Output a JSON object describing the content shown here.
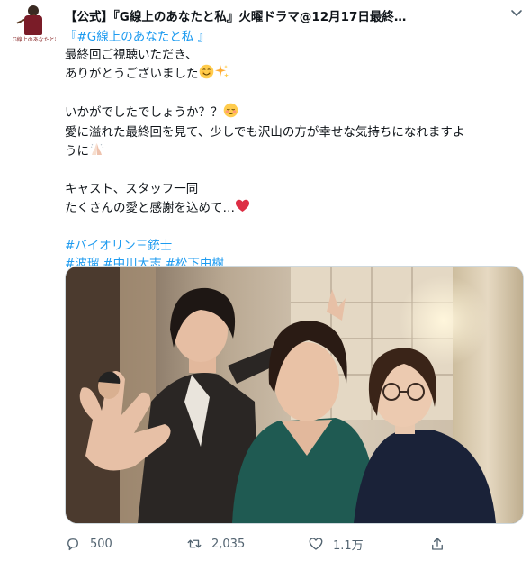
{
  "author": {
    "avatar_logo_text": "G線上のあなたと私",
    "name_line": "【公式】『G線上のあなたと私』火曜ドラマ@12月17日最終…"
  },
  "tweet": {
    "title_tag": "『#G線上のあなたと私 』",
    "lines": [
      "最終回ご視聴いただき、",
      "ありがとうございました",
      "いかがでしたでしょうか？？",
      "愛に溢れた最終回を見て、少しでも沢山の方が幸せな気持ちになれますよ",
      "うに",
      "キャスト、スタッフ一同",
      "たくさんの愛と感謝を込めて…"
    ],
    "hashtags_line1": [
      "#バイオリン三銃士"
    ],
    "hashtags_line2": [
      "#波瑠",
      "#中川大志",
      "#松下由樹"
    ]
  },
  "stats": {
    "replies": "500",
    "retweets": "2,035",
    "likes": "1.1万"
  },
  "icons": {
    "more": "chevron-down-icon",
    "reply": "reply-icon",
    "retweet": "retweet-icon",
    "like": "heart-icon",
    "share": "share-icon"
  },
  "colors": {
    "accent": "#1d9bf0",
    "text": "#0f1419",
    "muted": "#536471"
  }
}
